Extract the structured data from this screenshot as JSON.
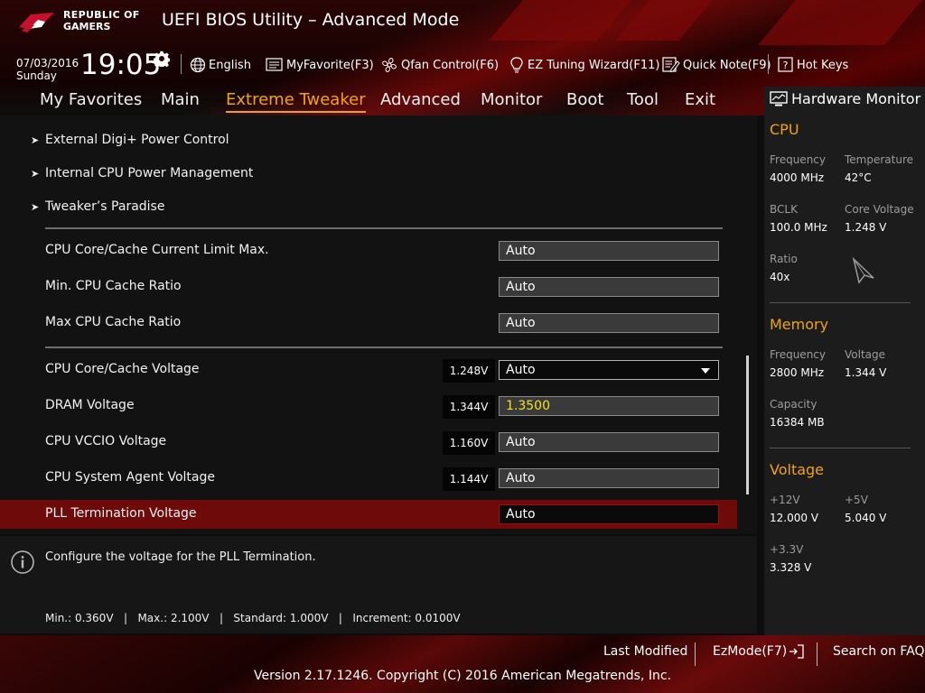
{
  "brand": {
    "line1": "REPUBLIC OF",
    "line2": "GAMERS"
  },
  "app_title": "UEFI BIOS Utility – Advanced Mode",
  "date": "07/03/2016",
  "day": "Sunday",
  "time": "19:05",
  "toolbar": {
    "language": "English",
    "favorite": "MyFavorite(F3)",
    "qfan": "Qfan Control(F6)",
    "ez_tuning": "EZ Tuning Wizard(F11)",
    "quick_note": "Quick Note(F9)",
    "hot_keys": "Hot Keys"
  },
  "nav": {
    "active": "Extreme Tweaker",
    "tabs": [
      "My Favorites",
      "Main",
      "Extreme Tweaker",
      "Advanced",
      "Monitor",
      "Boot",
      "Tool",
      "Exit"
    ]
  },
  "submenus": [
    "External Digi+ Power Control",
    "Internal CPU Power Management",
    "Tweaker’s Paradise"
  ],
  "settings_a": [
    {
      "label": "CPU Core/Cache Current Limit Max.",
      "value": "Auto"
    },
    {
      "label": "Min. CPU Cache Ratio",
      "value": "Auto"
    },
    {
      "label": "Max CPU Cache Ratio",
      "value": "Auto"
    }
  ],
  "settings_b": [
    {
      "label": "CPU Core/Cache Voltage",
      "current": "1.248V",
      "value": "Auto"
    },
    {
      "label": "DRAM Voltage",
      "current": "1.344V",
      "value": "1.3500"
    },
    {
      "label": "CPU VCCIO Voltage",
      "current": "1.160V",
      "value": "Auto"
    },
    {
      "label": "CPU System Agent Voltage",
      "current": "1.144V",
      "value": "Auto"
    },
    {
      "label": "PLL Termination Voltage",
      "value": "Auto"
    }
  ],
  "help": {
    "description": "Configure the voltage for the PLL Termination.",
    "range": "Min.: 0.360V   |   Max.: 2.100V   |   Standard: 1.000V   |   Increment: 0.0100V"
  },
  "hw_monitor": {
    "title": "Hardware Monitor",
    "cpu": {
      "heading": "CPU",
      "frequency_label": "Frequency",
      "frequency": "4000 MHz",
      "temperature_label": "Temperature",
      "temperature": "42°C",
      "bclk_label": "BCLK",
      "bclk": "100.0 MHz",
      "core_voltage_label": "Core Voltage",
      "core_voltage": "1.248 V",
      "ratio_label": "Ratio",
      "ratio": "40x"
    },
    "memory": {
      "heading": "Memory",
      "frequency_label": "Frequency",
      "frequency": "2800 MHz",
      "voltage_label": "Voltage",
      "voltage": "1.344 V",
      "capacity_label": "Capacity",
      "capacity": "16384 MB"
    },
    "voltage": {
      "heading": "Voltage",
      "v12_label": "+12V",
      "v12": "12.000 V",
      "v5_label": "+5V",
      "v5": "5.040 V",
      "v33_label": "+3.3V",
      "v33": "3.328 V"
    }
  },
  "footer": {
    "last_modified": "Last Modified",
    "ezmode": "EzMode(F7)",
    "search": "Search on FAQ",
    "copyright": "Version 2.17.1246. Copyright (C) 2016 American Megatrends, Inc."
  },
  "colors": {
    "accent": "#f2a30c",
    "selection": "#6e0a0a",
    "highlight_value": "#f5e01d"
  }
}
